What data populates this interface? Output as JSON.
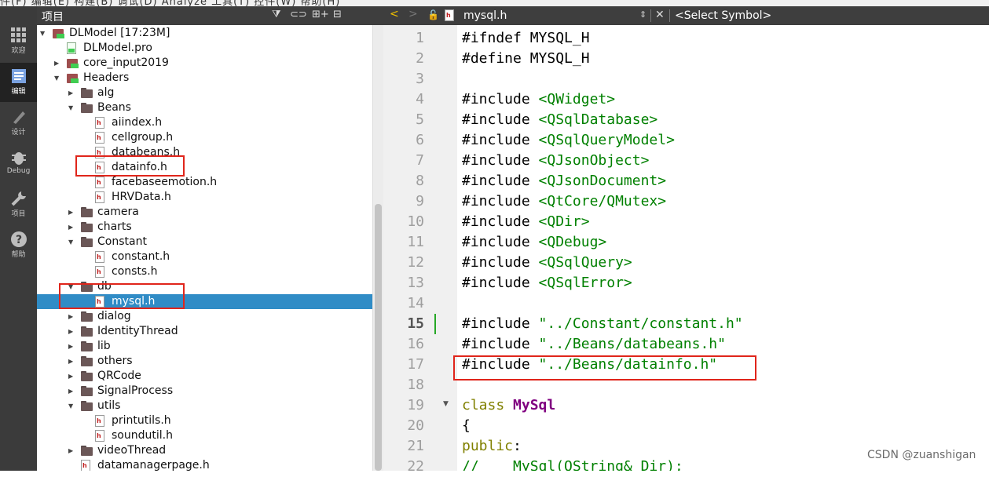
{
  "menu_strip": "件(F)  编辑(E)  构建(B)  调试(D)  Analyze  工具(T)  控件(W)  帮助(H)",
  "mode_bar": [
    {
      "label": "欢迎",
      "icon": "grid-icon"
    },
    {
      "label": "编辑",
      "icon": "edit-icon",
      "active": true
    },
    {
      "label": "设计",
      "icon": "pen-icon"
    },
    {
      "label": "Debug",
      "icon": "bug-icon"
    },
    {
      "label": "项目",
      "icon": "wrench-icon"
    },
    {
      "label": "帮助",
      "icon": "help-icon"
    }
  ],
  "project_panel": {
    "title": "项目",
    "toolbar": [
      "⧩",
      "⊂⊃",
      "⊞+",
      "⊟"
    ]
  },
  "tree": [
    {
      "label": "DLModel [17:23M]",
      "depth": 0,
      "kind": "project",
      "expanded": true
    },
    {
      "label": "DLModel.pro",
      "depth": 1,
      "kind": "pro"
    },
    {
      "label": "core_input2019",
      "depth": 1,
      "kind": "project",
      "expanded": false
    },
    {
      "label": "Headers",
      "depth": 1,
      "kind": "project",
      "expanded": true
    },
    {
      "label": "alg",
      "depth": 2,
      "kind": "folder",
      "expanded": false
    },
    {
      "label": "Beans",
      "depth": 2,
      "kind": "folder",
      "expanded": true
    },
    {
      "label": "aiindex.h",
      "depth": 3,
      "kind": "header"
    },
    {
      "label": "cellgroup.h",
      "depth": 3,
      "kind": "header"
    },
    {
      "label": "databeans.h",
      "depth": 3,
      "kind": "header"
    },
    {
      "label": "datainfo.h",
      "depth": 3,
      "kind": "header"
    },
    {
      "label": "facebaseemotion.h",
      "depth": 3,
      "kind": "header"
    },
    {
      "label": "HRVData.h",
      "depth": 3,
      "kind": "header"
    },
    {
      "label": "camera",
      "depth": 2,
      "kind": "folder",
      "expanded": false
    },
    {
      "label": "charts",
      "depth": 2,
      "kind": "folder",
      "expanded": false
    },
    {
      "label": "Constant",
      "depth": 2,
      "kind": "folder",
      "expanded": true
    },
    {
      "label": "constant.h",
      "depth": 3,
      "kind": "header"
    },
    {
      "label": "consts.h",
      "depth": 3,
      "kind": "header"
    },
    {
      "label": "db",
      "depth": 2,
      "kind": "folder",
      "expanded": true
    },
    {
      "label": "mysql.h",
      "depth": 3,
      "kind": "header",
      "selected": true
    },
    {
      "label": "dialog",
      "depth": 2,
      "kind": "folder",
      "expanded": false
    },
    {
      "label": "IdentityThread",
      "depth": 2,
      "kind": "folder",
      "expanded": false
    },
    {
      "label": "lib",
      "depth": 2,
      "kind": "folder",
      "expanded": false
    },
    {
      "label": "others",
      "depth": 2,
      "kind": "folder",
      "expanded": false
    },
    {
      "label": "QRCode",
      "depth": 2,
      "kind": "folder",
      "expanded": false
    },
    {
      "label": "SignalProcess",
      "depth": 2,
      "kind": "folder",
      "expanded": false
    },
    {
      "label": "utils",
      "depth": 2,
      "kind": "folder",
      "expanded": true
    },
    {
      "label": "printutils.h",
      "depth": 3,
      "kind": "header"
    },
    {
      "label": "soundutil.h",
      "depth": 3,
      "kind": "header"
    },
    {
      "label": "videoThread",
      "depth": 2,
      "kind": "folder",
      "expanded": false
    },
    {
      "label": "datamanagerpage.h",
      "depth": 2,
      "kind": "header"
    }
  ],
  "editor": {
    "file_name": "mysql.h",
    "symbol": "<Select Symbol>",
    "nav_back": "<",
    "nav_forward": ">",
    "close": "✕",
    "current_line": 15,
    "lines": [
      [
        {
          "t": "#ifndef MYSQL_H"
        }
      ],
      [
        {
          "t": "#define MYSQL_H"
        }
      ],
      [],
      [
        {
          "t": "#include "
        },
        {
          "t": "<QWidget>",
          "c": "str"
        }
      ],
      [
        {
          "t": "#include "
        },
        {
          "t": "<QSqlDatabase>",
          "c": "str"
        }
      ],
      [
        {
          "t": "#include "
        },
        {
          "t": "<QSqlQueryModel>",
          "c": "str"
        }
      ],
      [
        {
          "t": "#include "
        },
        {
          "t": "<QJsonObject>",
          "c": "str"
        }
      ],
      [
        {
          "t": "#include "
        },
        {
          "t": "<QJsonDocument>",
          "c": "str"
        }
      ],
      [
        {
          "t": "#include "
        },
        {
          "t": "<QtCore/QMutex>",
          "c": "str"
        }
      ],
      [
        {
          "t": "#include "
        },
        {
          "t": "<QDir>",
          "c": "str"
        }
      ],
      [
        {
          "t": "#include "
        },
        {
          "t": "<QDebug>",
          "c": "str"
        }
      ],
      [
        {
          "t": "#include "
        },
        {
          "t": "<QSqlQuery>",
          "c": "str"
        }
      ],
      [
        {
          "t": "#include "
        },
        {
          "t": "<QSqlError>",
          "c": "str"
        }
      ],
      [],
      [
        {
          "t": "#include "
        },
        {
          "t": "\"../Constant/constant.h\"",
          "c": "str"
        }
      ],
      [
        {
          "t": "#include "
        },
        {
          "t": "\"../Beans/databeans.h\"",
          "c": "str"
        }
      ],
      [
        {
          "t": "#include "
        },
        {
          "t": "\"../Beans/datainfo.h\"",
          "c": "str"
        }
      ],
      [],
      [
        {
          "t": "class ",
          "c": "kw"
        },
        {
          "t": "MySql",
          "c": "cls"
        }
      ],
      [
        {
          "t": "{"
        }
      ],
      [
        {
          "t": "public",
          "c": "kw"
        },
        {
          "t": ":"
        }
      ],
      [
        {
          "t": "//    MySql(QString& Dir);",
          "c": "cmt"
        }
      ]
    ]
  },
  "watermark": "CSDN @zuanshigan",
  "colors": {
    "selection": "#308cc6",
    "highlight_box": "#e0251b",
    "string": "#008000",
    "keyword": "#808000",
    "class": "#800080"
  }
}
